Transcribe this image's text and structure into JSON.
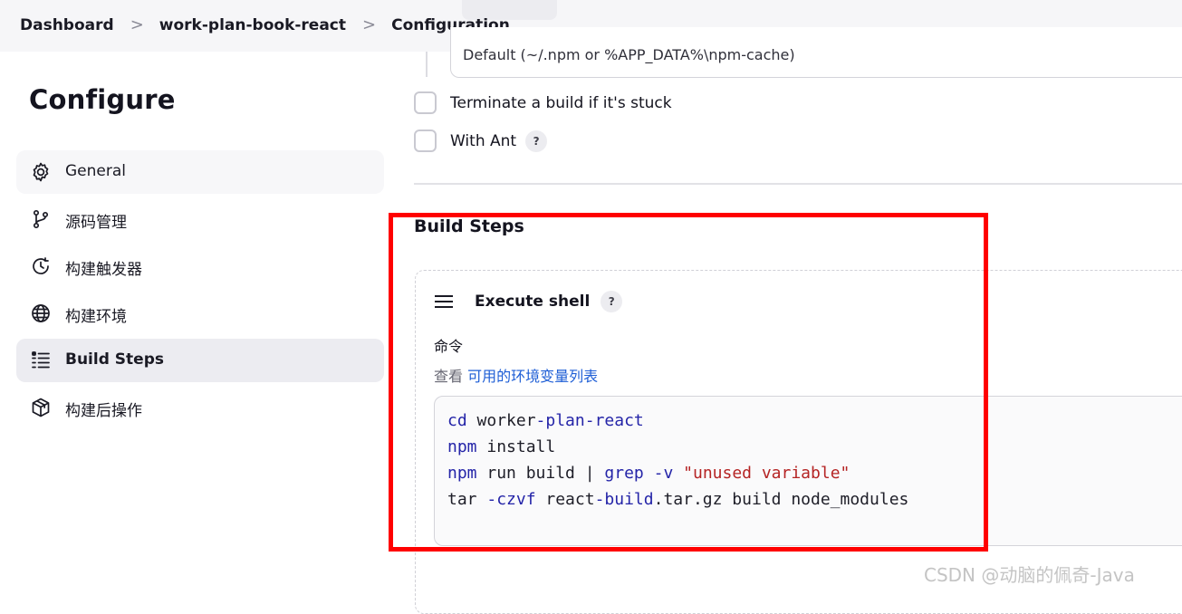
{
  "breadcrumb": {
    "items": [
      "Dashboard",
      "work-plan-book-react",
      "Configuration"
    ],
    "separator": ">"
  },
  "sidebar": {
    "title": "Configure",
    "items": [
      {
        "label": "General",
        "icon": "gear-icon"
      },
      {
        "label": "源码管理",
        "icon": "git-branch-icon"
      },
      {
        "label": "构建触发器",
        "icon": "clock-icon"
      },
      {
        "label": "构建环境",
        "icon": "globe-icon"
      },
      {
        "label": "Build Steps",
        "icon": "list-icon",
        "active": true
      },
      {
        "label": "构建后操作",
        "icon": "package-icon"
      }
    ]
  },
  "build_env": {
    "npm_cache_value": "Default (~/.npm or %APP_DATA%\\npm-cache)",
    "terminate_label": "Terminate a build if it's stuck",
    "with_ant_label": "With Ant",
    "help_glyph": "?"
  },
  "build_steps": {
    "title": "Build Steps",
    "step": {
      "title": "Execute shell",
      "command_label": "命令",
      "hint_prefix": "查看",
      "hint_link": "可用的环境变量列表",
      "code_lines": [
        [
          {
            "t": "cd",
            "c": "kw"
          },
          {
            "t": " worker"
          },
          {
            "t": "-plan-react",
            "c": "kw"
          }
        ],
        [
          {
            "t": "npm",
            "c": "kw"
          },
          {
            "t": " install"
          }
        ],
        [
          {
            "t": "npm",
            "c": "kw"
          },
          {
            "t": " run build | "
          },
          {
            "t": "grep",
            "c": "kw"
          },
          {
            "t": " "
          },
          {
            "t": "-v",
            "c": "kw"
          },
          {
            "t": " "
          },
          {
            "t": "\"unused variable\"",
            "c": "str"
          }
        ],
        [
          {
            "t": "tar "
          },
          {
            "t": "-czvf",
            "c": "kw"
          },
          {
            "t": " react"
          },
          {
            "t": "-build",
            "c": "kw"
          },
          {
            "t": ".tar.gz build node_modules"
          }
        ]
      ]
    }
  },
  "watermark": "CSDN @动脑的佩奇-Java",
  "colors": {
    "highlight_border": "#ff0000",
    "link": "#1f5fd6",
    "keyword": "#2424a8",
    "string": "#b52424"
  }
}
